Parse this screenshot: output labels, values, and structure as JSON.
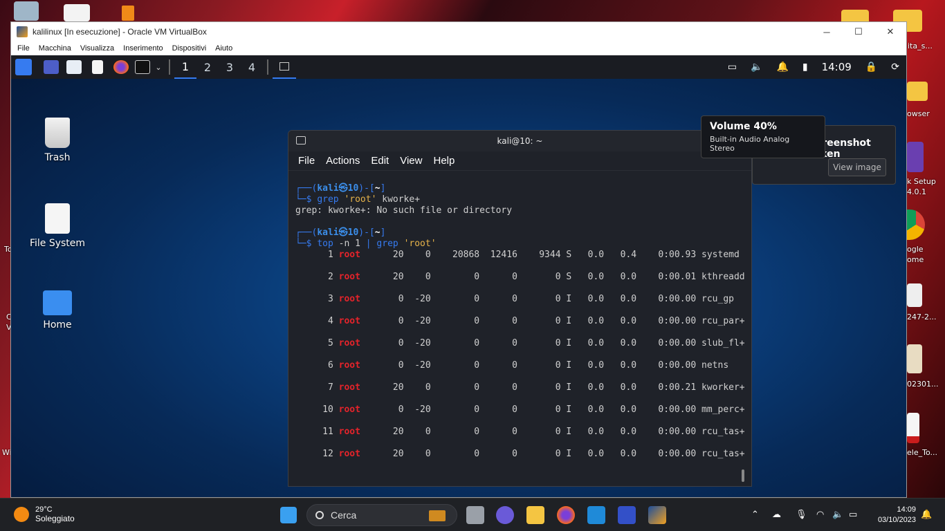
{
  "host_desktop": {
    "labels": [
      "ita_s...",
      "owser",
      "k Setup",
      "4.0.1",
      "ogle",
      "ome",
      "247-2...",
      "02301...",
      "ele_To...",
      "To",
      "Wi",
      "C",
      "V"
    ]
  },
  "vbox": {
    "title": "kalilinux [In esecuzione] - Oracle VM VirtualBox",
    "window_controls": {
      "minimize": "─",
      "maximize": "☐",
      "close": "✕"
    },
    "menu": [
      "File",
      "Macchina",
      "Visualizza",
      "Inserimento",
      "Dispositivi",
      "Aiuto"
    ]
  },
  "kali": {
    "workspaces": [
      "1",
      "2",
      "3",
      "4"
    ],
    "active_workspace": "1",
    "clock": "14:09",
    "desktop_icons": [
      {
        "name": "trash",
        "label": "Trash"
      },
      {
        "name": "filesystem",
        "label": "File System"
      },
      {
        "name": "home",
        "label": "Home"
      }
    ]
  },
  "terminal": {
    "title": "kali@10: ~",
    "menu": [
      "File",
      "Actions",
      "Edit",
      "View",
      "Help"
    ],
    "prompt": {
      "user": "kali",
      "at": "㉿",
      "host": "10",
      "dir": "~"
    },
    "cmd1": {
      "prog": "grep",
      "arg": "'root'",
      "rest": "kworke+"
    },
    "error": "grep: kworke+: No such file or directory",
    "cmd2": {
      "prog": "top",
      "flags": "-n 1",
      "pipe": "|",
      "prog2": "grep",
      "arg": "'root'"
    },
    "rows": [
      {
        "pid": "1",
        "user": "root",
        "pr": "20",
        "ni": "0",
        "virt": "20868",
        "res": "12416",
        "shr": "9344",
        "s": "S",
        "cpu": "0.0",
        "mem": "0.4",
        "time": "0:00.93",
        "cmd": "systemd"
      },
      {
        "pid": "2",
        "user": "root",
        "pr": "20",
        "ni": "0",
        "virt": "0",
        "res": "0",
        "shr": "0",
        "s": "S",
        "cpu": "0.0",
        "mem": "0.0",
        "time": "0:00.01",
        "cmd": "kthreadd"
      },
      {
        "pid": "3",
        "user": "root",
        "pr": "0",
        "ni": "-20",
        "virt": "0",
        "res": "0",
        "shr": "0",
        "s": "I",
        "cpu": "0.0",
        "mem": "0.0",
        "time": "0:00.00",
        "cmd": "rcu_gp"
      },
      {
        "pid": "4",
        "user": "root",
        "pr": "0",
        "ni": "-20",
        "virt": "0",
        "res": "0",
        "shr": "0",
        "s": "I",
        "cpu": "0.0",
        "mem": "0.0",
        "time": "0:00.00",
        "cmd": "rcu_par+"
      },
      {
        "pid": "5",
        "user": "root",
        "pr": "0",
        "ni": "-20",
        "virt": "0",
        "res": "0",
        "shr": "0",
        "s": "I",
        "cpu": "0.0",
        "mem": "0.0",
        "time": "0:00.00",
        "cmd": "slub_fl+"
      },
      {
        "pid": "6",
        "user": "root",
        "pr": "0",
        "ni": "-20",
        "virt": "0",
        "res": "0",
        "shr": "0",
        "s": "I",
        "cpu": "0.0",
        "mem": "0.0",
        "time": "0:00.00",
        "cmd": "netns"
      },
      {
        "pid": "7",
        "user": "root",
        "pr": "20",
        "ni": "0",
        "virt": "0",
        "res": "0",
        "shr": "0",
        "s": "I",
        "cpu": "0.0",
        "mem": "0.0",
        "time": "0:00.21",
        "cmd": "kworker+"
      },
      {
        "pid": "10",
        "user": "root",
        "pr": "0",
        "ni": "-20",
        "virt": "0",
        "res": "0",
        "shr": "0",
        "s": "I",
        "cpu": "0.0",
        "mem": "0.0",
        "time": "0:00.00",
        "cmd": "mm_perc+"
      },
      {
        "pid": "11",
        "user": "root",
        "pr": "20",
        "ni": "0",
        "virt": "0",
        "res": "0",
        "shr": "0",
        "s": "I",
        "cpu": "0.0",
        "mem": "0.0",
        "time": "0:00.00",
        "cmd": "rcu_tas+"
      },
      {
        "pid": "12",
        "user": "root",
        "pr": "20",
        "ni": "0",
        "virt": "0",
        "res": "0",
        "shr": "0",
        "s": "I",
        "cpu": "0.0",
        "mem": "0.0",
        "time": "0:00.00",
        "cmd": "rcu_tas+"
      }
    ]
  },
  "volume_tooltip": {
    "title": "Volume 40%",
    "device": "Built-in Audio Analog Stereo"
  },
  "notification": {
    "title": "Screenshot taken",
    "button": "View image"
  },
  "taskbar": {
    "weather_temp": "29°C",
    "weather_desc": "Soleggiato",
    "search_placeholder": "Cerca",
    "time": "14:09",
    "date": "03/10/2023"
  },
  "colors": {
    "kali_blue": "#367bf0",
    "root_red": "#e4232a",
    "string_yellow": "#e8b44a"
  }
}
